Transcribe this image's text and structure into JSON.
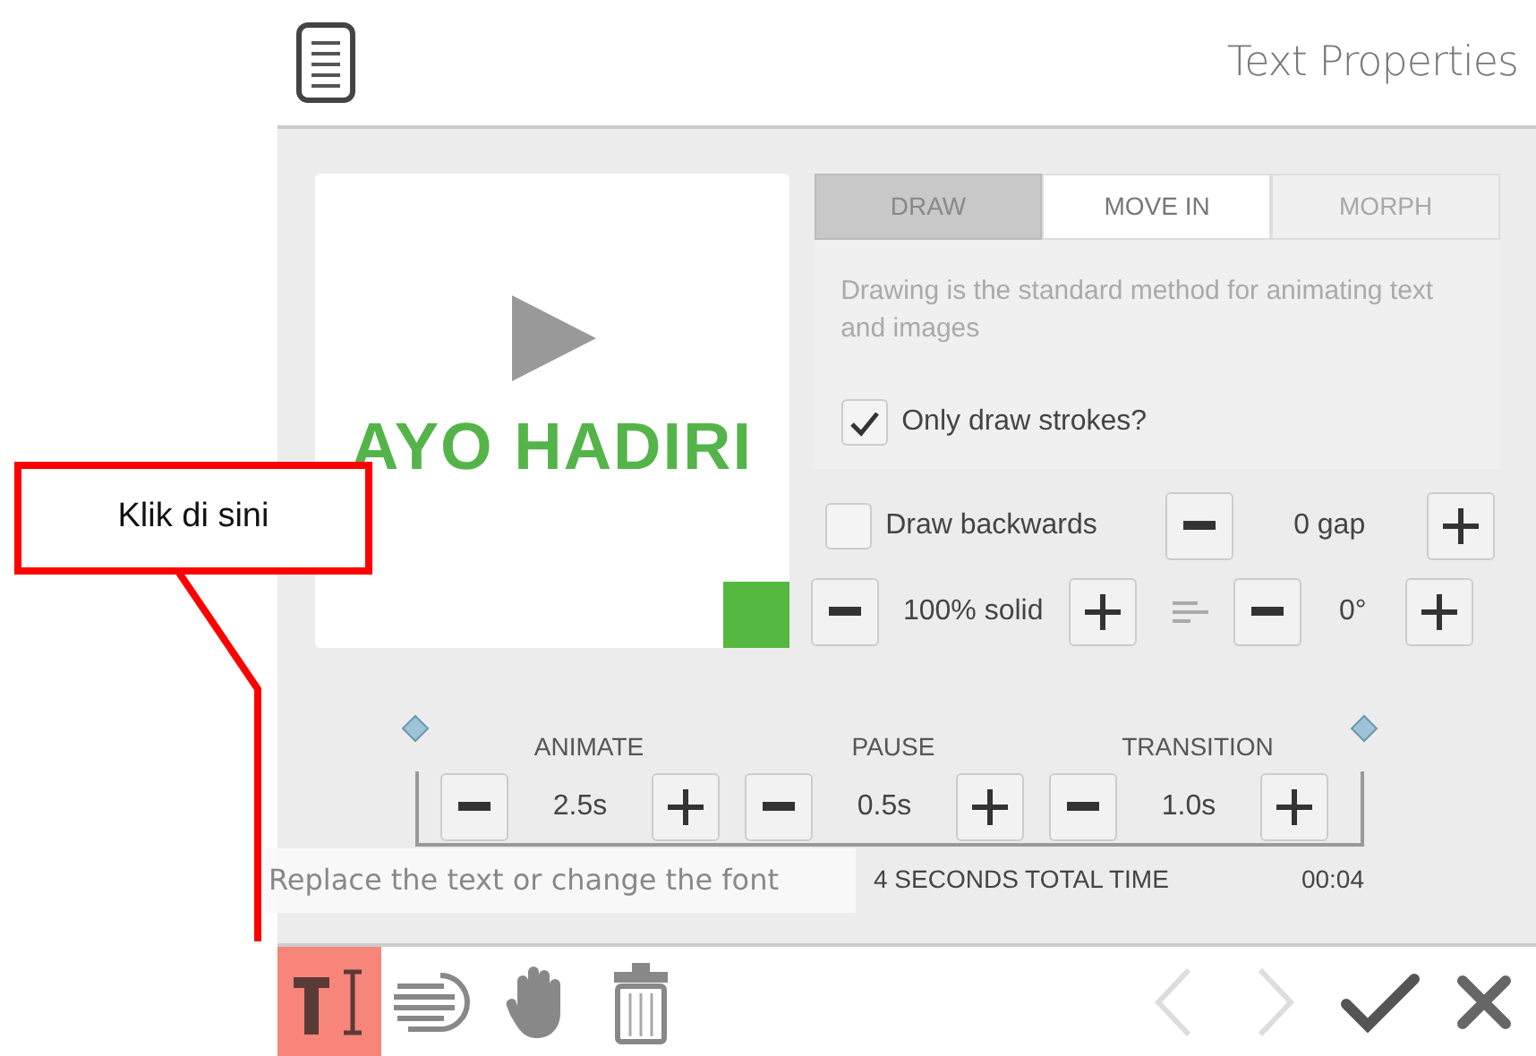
{
  "header": {
    "title": "Text Properties"
  },
  "preview": {
    "text": "AYO HADIRI"
  },
  "modes": [
    {
      "label": "DRAW",
      "selected": true,
      "disabled": false
    },
    {
      "label": "MOVE IN",
      "selected": false,
      "disabled": false
    },
    {
      "label": "MORPH",
      "selected": false,
      "disabled": true
    }
  ],
  "description": "Drawing is the standard method for animating text and images",
  "strokes_option": {
    "label": "Only draw strokes?",
    "checked": true
  },
  "backwards_option": {
    "label": "Draw backwards",
    "checked": false
  },
  "steppers": [
    {
      "value": "0 gap"
    },
    {
      "value": "100% solid"
    },
    {
      "value": "0°"
    }
  ],
  "timeline": {
    "segments": [
      {
        "label": "ANIMATE",
        "value": "2.5s"
      },
      {
        "label": "PAUSE",
        "value": "0.5s"
      },
      {
        "label": "TRANSITION",
        "value": "1.0s"
      }
    ],
    "total": "4 SECONDS TOTAL TIME",
    "end": "00:04"
  },
  "tooltip": "Replace the text or change the font",
  "tools": [
    {
      "kind": "text",
      "selected": true
    },
    {
      "kind": "lines",
      "selected": false
    },
    {
      "kind": "hand",
      "selected": false
    },
    {
      "kind": "trash",
      "selected": false
    }
  ],
  "nav": [
    {
      "kind": "prev",
      "disabled": true
    },
    {
      "kind": "next",
      "disabled": true
    },
    {
      "kind": "check",
      "disabled": false
    },
    {
      "kind": "close",
      "disabled": false
    }
  ],
  "callout": {
    "text": "Klik di sini"
  }
}
